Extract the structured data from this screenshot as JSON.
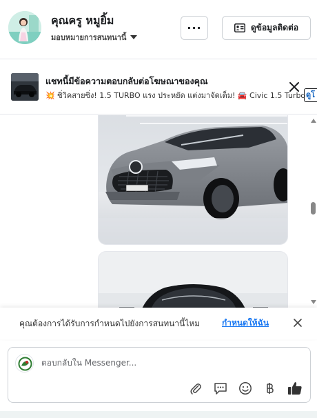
{
  "header": {
    "contact_name": "คุณครู หมูยิ้ม",
    "assign_label": "มอบหมายการสนทนานี้",
    "more_label": "···",
    "contact_info_label": "ดูข้อมูลติดต่อ"
  },
  "ad_banner": {
    "title": "แชทนี้มีข้อความตอบกลับต่อโฆษณาของคุณ",
    "snippet": "💥 ซิ่วิคสายซิ่ง! 1.5 TURBO แรง ประหยัด แต่งมาจัดเต็ม! 🚘 Civic 1.5 Turbo",
    "view_label": "ดูโ"
  },
  "prompt": {
    "text": "คุณต้องการได้รับการกำหนดไปยังการสนทนานี้ไหม",
    "link": "กำหนดให้ฉัน"
  },
  "composer": {
    "placeholder": "ตอบกลับใน Messenger..."
  },
  "icons": [
    "caret-down-icon",
    "contact-card-icon",
    "close-icon",
    "attachment-icon",
    "saved-reply-icon",
    "emoji-icon",
    "baht-icon",
    "thumbs-up-icon"
  ],
  "colors": {
    "link_blue": "#1877f2",
    "car_grey": "#7d8187",
    "border": "#ccd0d5"
  }
}
